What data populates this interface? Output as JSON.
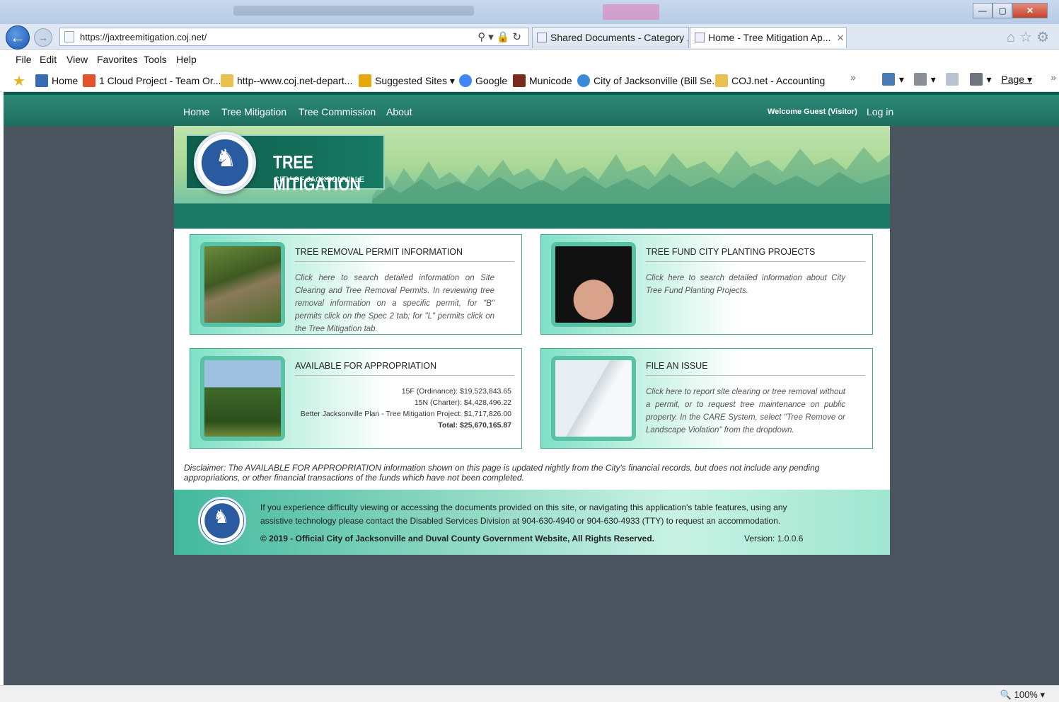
{
  "browser": {
    "address_url": "https://jaxtreemitigation.coj.net/",
    "tabs": [
      {
        "label": "Shared Documents - Category ..."
      },
      {
        "label": "Home - Tree Mitigation Ap...",
        "close": "✕"
      }
    ],
    "menu": [
      "File",
      "Edit",
      "View",
      "Favorites",
      "Tools",
      "Help"
    ],
    "favorites": [
      {
        "label": "Home",
        "color": "#3a6ab0"
      },
      {
        "label": "1 Cloud Project - Team Or...",
        "color": "#e3512b"
      },
      {
        "label": "http--www.coj.net-depart...",
        "color": "#e8c150"
      },
      {
        "label": "Suggested Sites ▾",
        "color": "#e8a70c"
      },
      {
        "label": "Google",
        "color": "#4285f4"
      },
      {
        "label": "Municode",
        "color": "#7a2c1c"
      },
      {
        "label": "City of Jacksonville (Bill Se...",
        "color": "#3b8ad8"
      },
      {
        "label": "COJ.net - Accounting",
        "color": "#e8c150"
      }
    ],
    "page_menu": "Page ▾",
    "zoom": "100%",
    "overflow": "»"
  },
  "site": {
    "nav": [
      "Home",
      "Tree Mitigation",
      "Tree Commission",
      "About"
    ],
    "welcome": "Welcome Guest (Visitor)",
    "login": "Log in",
    "logo_title": "TREE MITIGATION",
    "logo_sub": "CITY OF JACKSONVILLE"
  },
  "cards": [
    {
      "title": "TREE REMOVAL PERMIT INFORMATION",
      "text": "Click here to search detailed information on Site Clearing and Tree Removal Permits. In reviewing tree removal information on a specific permit, for \"B\" permits click on the Spec 2 tab; for \"L\" permits click on the Tree Mitigation tab."
    },
    {
      "title": "TREE FUND CITY PLANTING PROJECTS",
      "text": "Click here to search detailed information about City Tree Fund Planting Projects."
    },
    {
      "title": "AVAILABLE FOR APPROPRIATION",
      "amounts": [
        "15F (Ordinance): $19,523,843.65",
        "15N (Charter): $4,428,496.22",
        "Better Jacksonville Plan - Tree Mitigation Project: $1,717,826.00"
      ],
      "total": "Total: $25,670,165.87"
    },
    {
      "title": "FILE AN ISSUE",
      "text": "Click here to report site clearing or tree removal without a permit, or to request tree maintenance on public property. In the CARE System, select \"Tree Remove or Landscape Violation\" from the dropdown."
    }
  ],
  "disclaimer": "Disclaimer: The AVAILABLE FOR APPROPRIATION information shown on this page is updated nightly from the City's financial records, but does not include any pending appropriations, or other financial transactions of the funds which have not been completed.",
  "footer": {
    "accessibility": "If you experience difficulty viewing or accessing the documents provided on this site, or navigating this application's table features, using any assistive technology please contact the Disabled Services Division at 904-630-4940 or 904-630-4933 (TTY) to request an accommodation.",
    "copyright": "© 2019 - Official City of Jacksonville and Duval County Government Website, All Rights Reserved.",
    "version": "Version: 1.0.0.6"
  }
}
